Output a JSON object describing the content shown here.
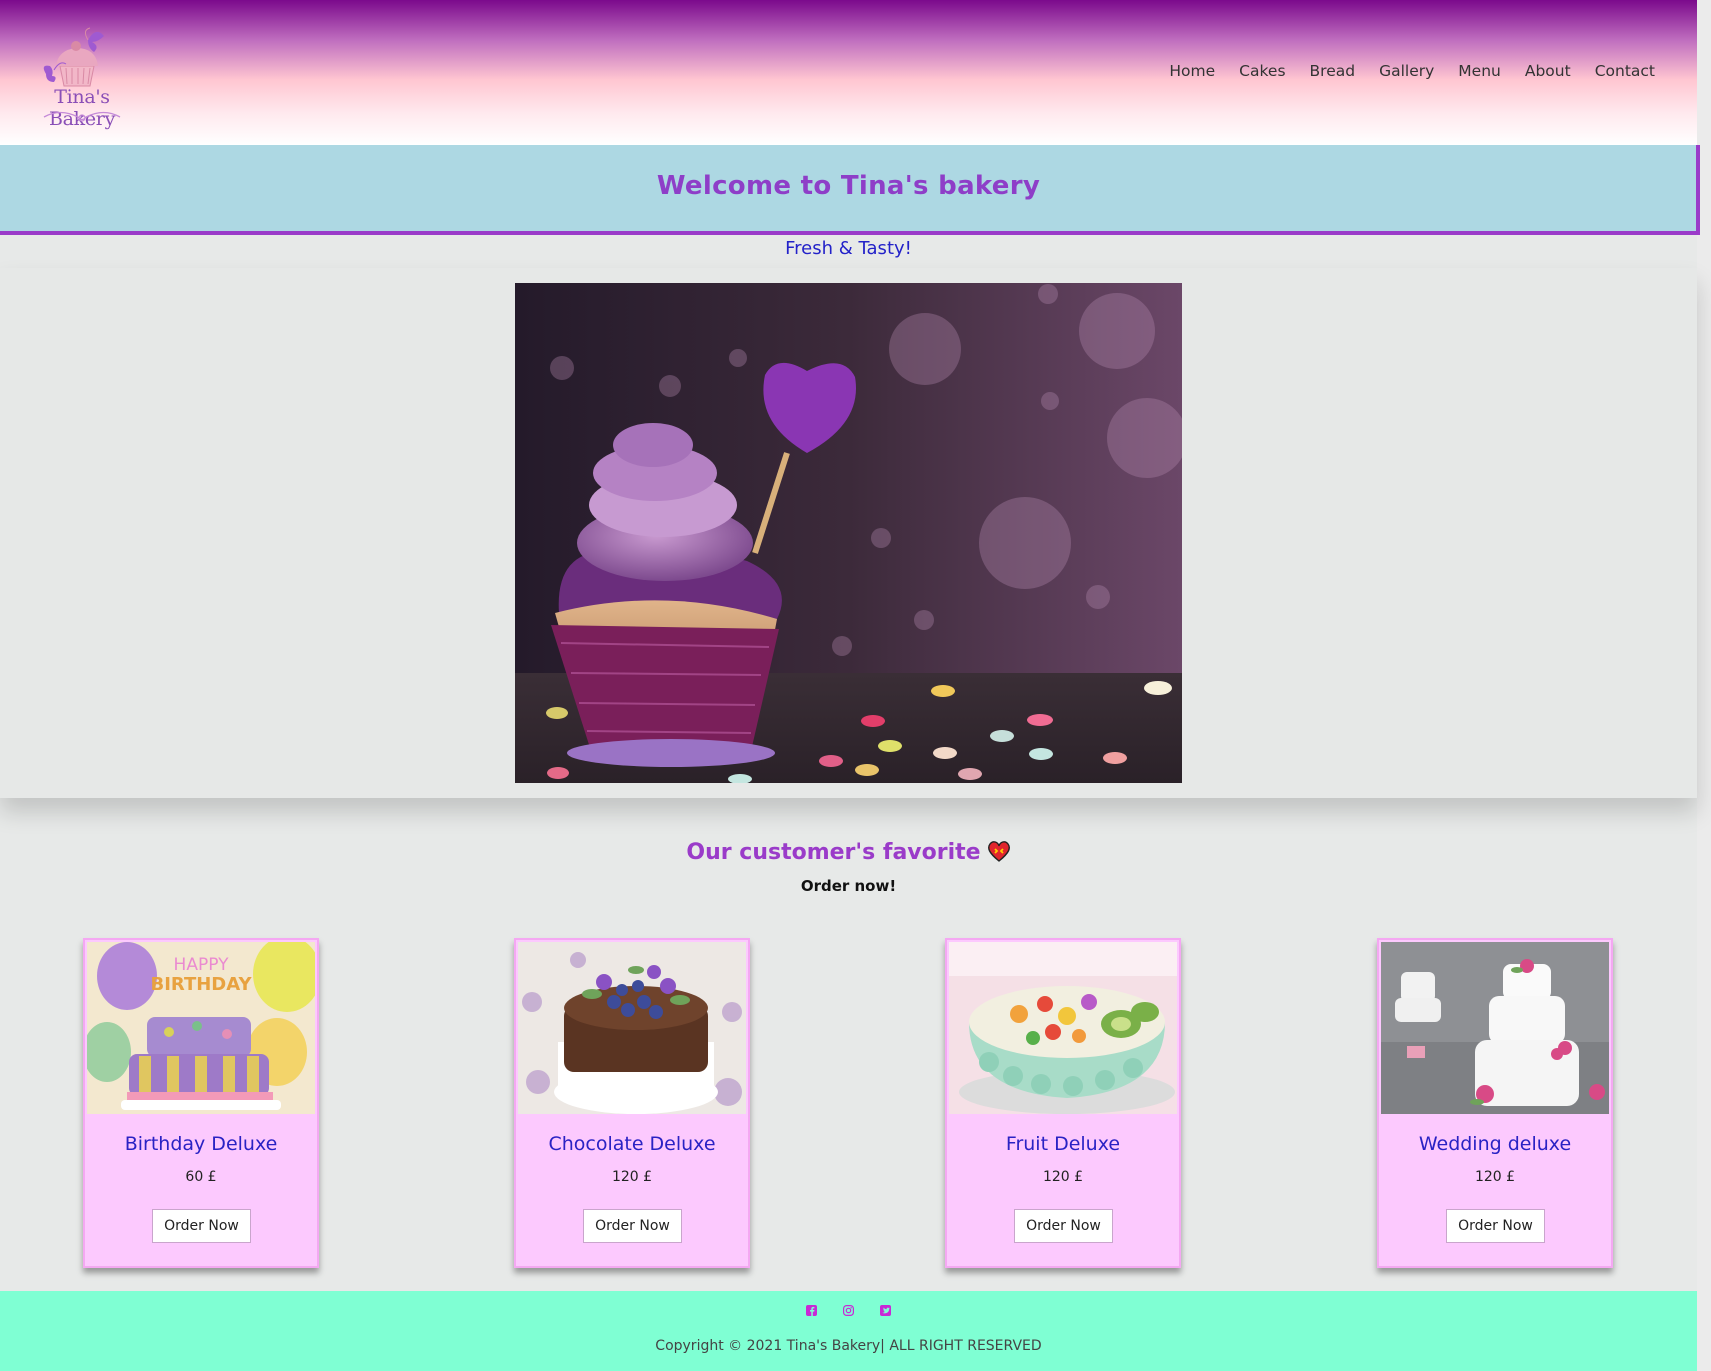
{
  "brand": {
    "name": "Tina's Bakery"
  },
  "nav": {
    "items": [
      "Home",
      "Cakes",
      "Bread",
      "Gallery",
      "Menu",
      "About",
      "Contact"
    ]
  },
  "banner": {
    "title": "Welcome to Tina's bakery",
    "tagline": "Fresh & Tasty!"
  },
  "favorites": {
    "title": "Our customer's favorite",
    "subtitle": "Order now!"
  },
  "products": [
    {
      "name": "Birthday Deluxe",
      "price": "60 £",
      "button": "Order Now"
    },
    {
      "name": "Chocolate Deluxe",
      "price": "120 £",
      "button": "Order Now"
    },
    {
      "name": "Fruit Deluxe",
      "price": "120 £",
      "button": "Order Now"
    },
    {
      "name": "Wedding deluxe",
      "price": "120 £",
      "button": "Order Now"
    }
  ],
  "footer": {
    "social": [
      "facebook-icon",
      "instagram-icon",
      "twitter-icon"
    ],
    "copyright": "Copyright © 2021 Tina's Bakery| ALL RIGHT RESERVED"
  },
  "colors": {
    "accent_purple": "#9a3bc9",
    "banner_bg": "#add8e3",
    "card_bg": "#fcc9fe",
    "footer_bg": "#7fffd3",
    "product_title": "#2a22c4"
  }
}
